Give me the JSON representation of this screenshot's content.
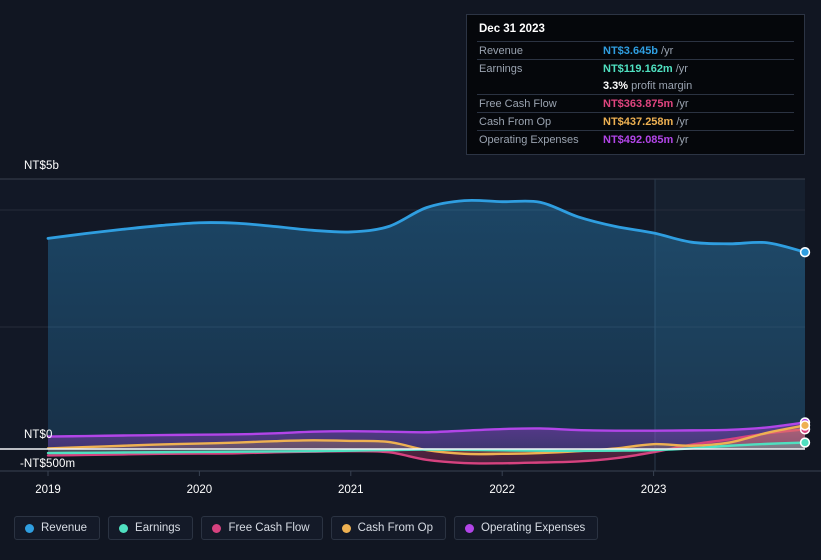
{
  "axes": {
    "y_top_label": "NT$5b",
    "y_zero_label": "NT$0",
    "y_bottom_label": "-NT$500m",
    "x_labels": [
      "2019",
      "2020",
      "2021",
      "2022",
      "2023"
    ]
  },
  "tooltip": {
    "date": "Dec 31 2023",
    "rows": [
      {
        "key": "Revenue",
        "value": "NT$3.645b",
        "suffix": "/yr",
        "color": "#2f9ee0"
      },
      {
        "key": "Earnings",
        "value": "NT$119.162m",
        "suffix": "/yr",
        "color": "#4fe0c0"
      },
      {
        "key": "",
        "value": "3.3%",
        "suffix": "profit margin",
        "color": "#ffffff"
      },
      {
        "key": "Free Cash Flow",
        "value": "NT$363.875m",
        "suffix": "/yr",
        "color": "#e0457f"
      },
      {
        "key": "Cash From Op",
        "value": "NT$437.258m",
        "suffix": "/yr",
        "color": "#eeb152"
      },
      {
        "key": "Operating Expenses",
        "value": "NT$492.085m",
        "suffix": "/yr",
        "color": "#b245e8"
      }
    ]
  },
  "legend": {
    "items": [
      {
        "label": "Revenue",
        "color": "#2f9ee0"
      },
      {
        "label": "Earnings",
        "color": "#4fe0c0"
      },
      {
        "label": "Free Cash Flow",
        "color": "#d6427f"
      },
      {
        "label": "Cash From Op",
        "color": "#eeb152"
      },
      {
        "label": "Operating Expenses",
        "color": "#b245e8"
      }
    ]
  },
  "chart_data": {
    "type": "area",
    "title": "",
    "xlabel": "",
    "ylabel": "",
    "ylim": [
      -500000000,
      5000000000
    ],
    "y_ticks": [
      {
        "label": "NT$5b",
        "value": 5000000000
      },
      {
        "label": "NT$0",
        "value": 0
      },
      {
        "label": "-NT$500m",
        "value": -500000000
      }
    ],
    "grid": true,
    "legend_position": "bottom",
    "currency": "NT$",
    "x": [
      2019.0,
      2019.25,
      2019.5,
      2019.75,
      2020.0,
      2020.25,
      2020.5,
      2020.75,
      2021.0,
      2021.25,
      2021.5,
      2021.75,
      2022.0,
      2022.25,
      2022.5,
      2022.75,
      2023.0,
      2023.25,
      2023.5,
      2023.75,
      2024.0
    ],
    "x_tick_labels": [
      "2019",
      "2020",
      "2021",
      "2022",
      "2023"
    ],
    "forecast_start": 2023.0,
    "series": [
      {
        "name": "Revenue",
        "color": "#2f9ee0",
        "values": [
          3.9,
          3.99,
          4.07,
          4.14,
          4.19,
          4.18,
          4.12,
          4.05,
          4.02,
          4.12,
          4.47,
          4.6,
          4.58,
          4.57,
          4.3,
          4.12,
          4.0,
          3.83,
          3.8,
          3.82,
          3.645
        ],
        "units": "NT$b"
      },
      {
        "name": "Earnings",
        "color": "#4fe0c0",
        "values": [
          -0.075,
          -0.07,
          -0.065,
          -0.06,
          -0.055,
          -0.05,
          -0.045,
          -0.04,
          -0.03,
          -0.02,
          -0.01,
          -0.015,
          -0.025,
          -0.03,
          -0.035,
          -0.03,
          -0.02,
          0.01,
          0.06,
          0.095,
          0.119162
        ],
        "units": "NT$b"
      },
      {
        "name": "Free Cash Flow",
        "color": "#d6427f",
        "values": [
          -0.12,
          -0.11,
          -0.1,
          -0.09,
          -0.085,
          -0.08,
          -0.06,
          -0.05,
          -0.04,
          -0.06,
          -0.2,
          -0.26,
          -0.265,
          -0.25,
          -0.23,
          -0.17,
          -0.06,
          0.08,
          0.18,
          0.29,
          0.363875
        ],
        "units": "NT$b"
      },
      {
        "name": "Cash From Op",
        "color": "#eeb152",
        "values": [
          0.01,
          0.035,
          0.06,
          0.085,
          0.1,
          0.12,
          0.145,
          0.16,
          0.15,
          0.13,
          -0.02,
          -0.09,
          -0.09,
          -0.075,
          -0.04,
          0.01,
          0.09,
          0.06,
          0.12,
          0.3,
          0.437258
        ],
        "units": "NT$b"
      },
      {
        "name": "Operating Expenses",
        "color": "#b245e8",
        "values": [
          0.23,
          0.24,
          0.25,
          0.258,
          0.265,
          0.272,
          0.29,
          0.32,
          0.33,
          0.32,
          0.31,
          0.34,
          0.37,
          0.38,
          0.35,
          0.34,
          0.34,
          0.345,
          0.355,
          0.4,
          0.492085
        ],
        "units": "NT$b"
      }
    ]
  }
}
